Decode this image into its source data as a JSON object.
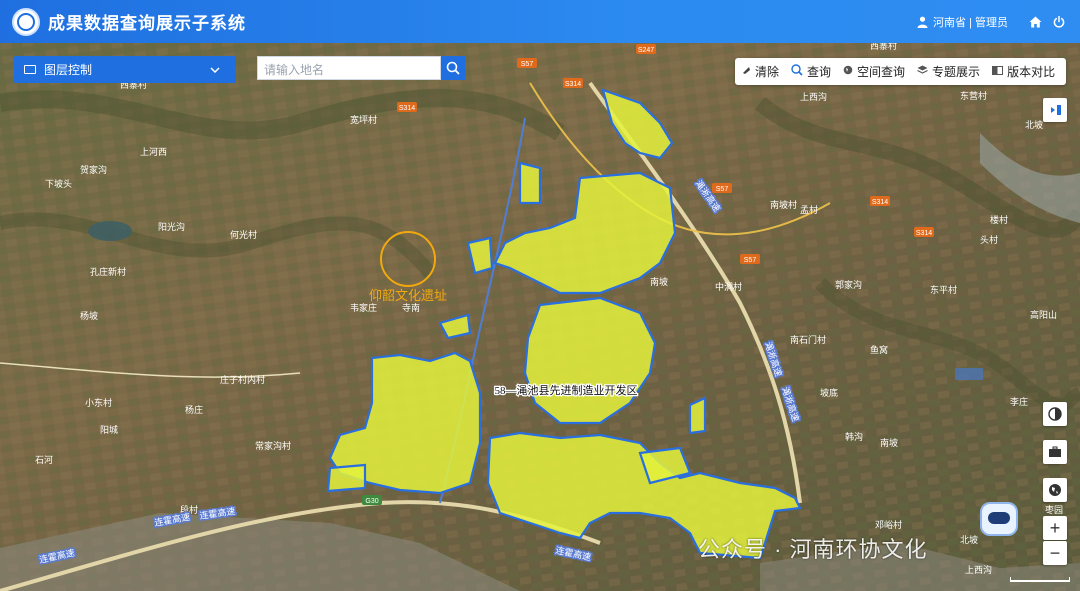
{
  "header": {
    "title": "成果数据查询展示子系统",
    "user": "河南省 | 管理员"
  },
  "layer_control": {
    "label": "图层控制"
  },
  "search": {
    "placeholder": "请输入地名"
  },
  "toolbar": {
    "items": [
      {
        "label": "清除",
        "icon": "eraser-icon"
      },
      {
        "label": "查询",
        "icon": "search-icon"
      },
      {
        "label": "空间查询",
        "icon": "globe-icon"
      },
      {
        "label": "专题展示",
        "icon": "layers-icon"
      },
      {
        "label": "版本对比",
        "icon": "compare-icon"
      }
    ]
  },
  "map": {
    "zone_label": "58—渑池县先进制造业开发区",
    "site_label": "仰韶文化遗址",
    "colors": {
      "zone_fill": "#e4f23c",
      "zone_stroke": "#2a6fe0",
      "site_ring": "#f2a90d",
      "road": "#f0c34a",
      "accent": "#1f6fe0"
    },
    "place_names": [
      "西寨村",
      "宽坪村",
      "上河西",
      "下坡头",
      "贺家沟",
      "阳光沟",
      "何光村",
      "孔庄新村",
      "杨坡",
      "寺南",
      "南坡",
      "韦家庄",
      "庄子村内村",
      "小东村",
      "杨庄",
      "常家沟村",
      "石河",
      "段村",
      "中洞村",
      "南石门村",
      "阳城",
      "高阳山",
      "李庄",
      "头村",
      "楼村",
      "东平村",
      "鱼窝",
      "北坡",
      "西寨村",
      "上西沟",
      "北坡",
      "坡底",
      "韩沟",
      "南坡",
      "郭家沟",
      "孟村",
      "南坡村",
      "上西沟",
      "东营村",
      "枣园",
      "邓峪村"
    ],
    "road_badges": [
      "S57",
      "S314",
      "G30",
      "S247",
      "S314",
      "S314",
      "S57",
      "S57",
      "S314"
    ],
    "highways": [
      "连霍高速",
      "连霍高速",
      "连霍高速",
      "连霍高速",
      "渑淅高速",
      "渑淅高速",
      "渑淅高速"
    ]
  },
  "controls": {
    "collapse": "collapse-panel-icon",
    "contrast": "contrast-icon",
    "basemap": "briefcase-icon",
    "globe": "globe-icon",
    "zoom_in": "+",
    "zoom_out": "−"
  },
  "watermark": {
    "text": "公众号 · 河南环协文化"
  }
}
